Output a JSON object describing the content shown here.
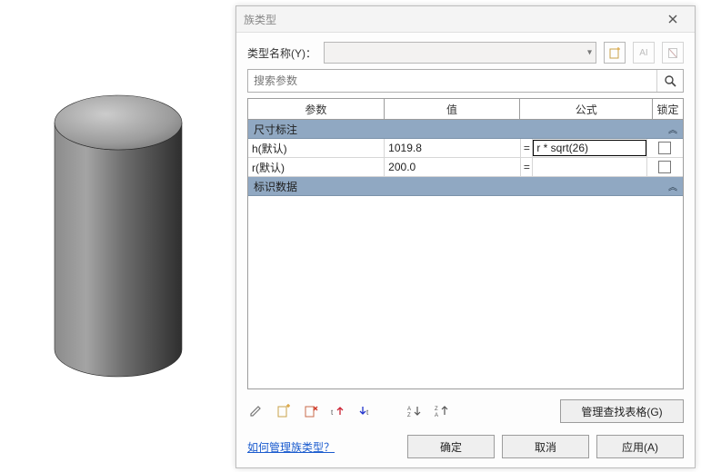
{
  "dialog": {
    "title": "族类型",
    "type_name_label": "类型名称(Y)：",
    "type_combo_value": "",
    "type_icons": {
      "new": "new-type-icon",
      "rename": "rename-type-icon",
      "delete": "delete-type-icon"
    },
    "search_placeholder": "搜索参数"
  },
  "table": {
    "headers": {
      "param": "参数",
      "value": "值",
      "formula": "公式",
      "lock": "锁定"
    },
    "groups": [
      {
        "name": "尺寸标注",
        "rows": [
          {
            "param": "h(默认)",
            "value": "1019.8",
            "formula": "r * sqrt(26)",
            "locked": false,
            "active_formula": true
          },
          {
            "param": "r(默认)",
            "value": "200.0",
            "formula": "",
            "locked": false,
            "active_formula": false
          }
        ]
      },
      {
        "name": "标识数据",
        "rows": []
      }
    ]
  },
  "toolbar": {
    "manage_lookup": "管理查找表格(G)"
  },
  "footer": {
    "help_link": "如何管理族类型？",
    "ok": "确定",
    "cancel": "取消",
    "apply": "应用(A)"
  }
}
